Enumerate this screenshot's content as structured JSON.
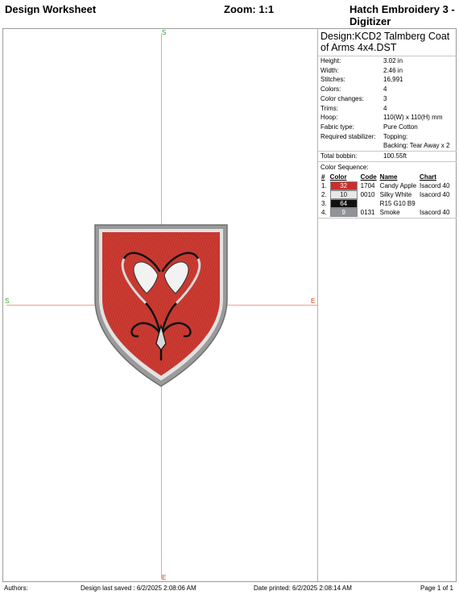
{
  "header": {
    "left": "Design Worksheet",
    "zoom": "Zoom:  1:1",
    "right": "Hatch Embroidery 3 - Digitizer"
  },
  "canvas": {
    "label_top": "S",
    "label_left": "S",
    "label_right": "E",
    "label_bottom": "E"
  },
  "design": {
    "name": "Design:KCD2 Talmberg Coat of Arms 4x4.DST",
    "fields": [
      {
        "k": "Height:",
        "v": "3.02 in"
      },
      {
        "k": "Width:",
        "v": "2.46 in"
      },
      {
        "k": "Stitches:",
        "v": "16,991"
      },
      {
        "k": "Colors:",
        "v": "4"
      },
      {
        "k": "Color changes:",
        "v": "3"
      },
      {
        "k": "Trims:",
        "v": "4"
      },
      {
        "k": "Hoop:",
        "v": "110(W) x 110(H) mm"
      },
      {
        "k": "Fabric type:",
        "v": "Pure Cotton"
      },
      {
        "k": "Required stabilizer:",
        "v": "Topping:"
      },
      {
        "k": "",
        "v": "Backing: Tear Away x 2"
      },
      {
        "k": "Total bobbin:",
        "v": "100.55ft"
      }
    ]
  },
  "color_sequence": {
    "label": "Color Sequence:",
    "headers": {
      "num": "#",
      "color": "Color",
      "code": "Code",
      "name": "Name",
      "chart": "Chart"
    },
    "rows": [
      {
        "num": "1.",
        "swatch": "32",
        "hex": "#c8302c",
        "code": "1704",
        "name": "Candy Apple",
        "chart": "Isacord 40"
      },
      {
        "num": "2.",
        "swatch": "10",
        "hex": "#e8e8e8",
        "code": "0010",
        "name": "Silky White",
        "chart": "Isacord 40"
      },
      {
        "num": "3.",
        "swatch": "64",
        "hex": "#111111",
        "code": "",
        "name": "R15 G10 B9",
        "chart": ""
      },
      {
        "num": "4.",
        "swatch": "9",
        "hex": "#8e9499",
        "code": "0131",
        "name": "Smoke",
        "chart": "Isacord 40"
      }
    ]
  },
  "footer": {
    "authors": "Authors:",
    "saved": "Design last saved : 6/2/2025 2:08:06 AM",
    "printed": "Date printed: 6/2/2025 2:08:14 AM",
    "page": "Page 1 of 1"
  }
}
